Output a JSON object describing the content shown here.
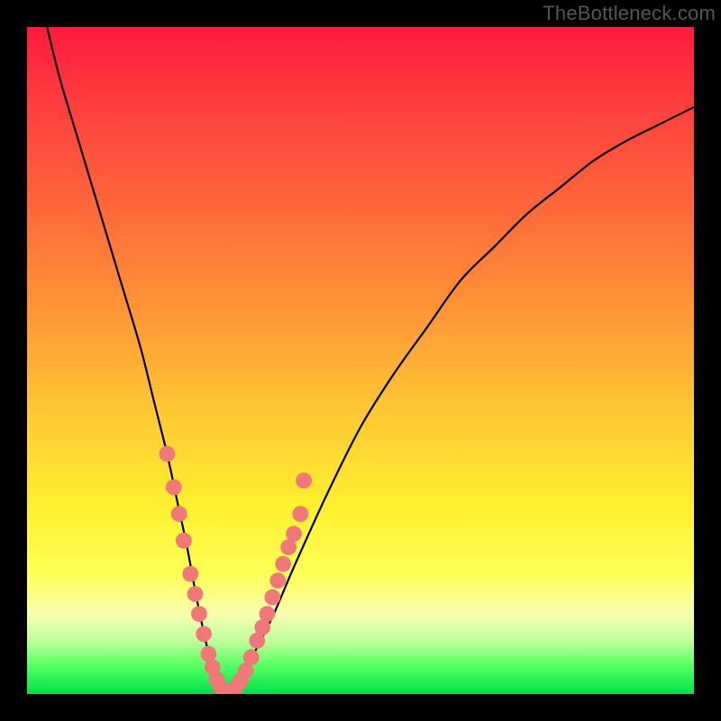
{
  "watermark": "TheBottleneck.com",
  "chart_data": {
    "type": "line",
    "title": "",
    "xlabel": "",
    "ylabel": "",
    "xlim": [
      0,
      100
    ],
    "ylim": [
      0,
      100
    ],
    "background_gradient": [
      "#ff1a3c",
      "#ff6a3a",
      "#ffc933",
      "#ffff55",
      "#00e04a"
    ],
    "series": [
      {
        "name": "bottleneck-curve",
        "color": "#000000",
        "x": [
          3,
          5,
          8,
          11,
          14,
          17,
          19,
          21,
          22.5,
          24,
          25.5,
          27,
          28,
          29,
          30,
          32,
          34,
          37,
          40,
          45,
          50,
          55,
          60,
          65,
          70,
          75,
          80,
          85,
          90,
          95,
          100
        ],
        "y": [
          100,
          92,
          82,
          72,
          62,
          52,
          44,
          36,
          29,
          22,
          14,
          7,
          3,
          0.5,
          0,
          2,
          6,
          12,
          19,
          30,
          40,
          48,
          55,
          62,
          67,
          72,
          76,
          80,
          83,
          85.5,
          88
        ]
      }
    ],
    "markers": [
      {
        "name": "highlight-dots",
        "color": "#f07878",
        "radius": 1.2,
        "points": [
          {
            "x": 21.0,
            "y": 36
          },
          {
            "x": 22.0,
            "y": 31
          },
          {
            "x": 22.8,
            "y": 27
          },
          {
            "x": 23.5,
            "y": 23
          },
          {
            "x": 24.5,
            "y": 18
          },
          {
            "x": 25.2,
            "y": 15
          },
          {
            "x": 25.8,
            "y": 12
          },
          {
            "x": 26.5,
            "y": 9
          },
          {
            "x": 27.2,
            "y": 6
          },
          {
            "x": 27.8,
            "y": 4
          },
          {
            "x": 28.4,
            "y": 2.2
          },
          {
            "x": 29.0,
            "y": 1
          },
          {
            "x": 29.5,
            "y": 0.4
          },
          {
            "x": 30.0,
            "y": 0.2
          },
          {
            "x": 30.6,
            "y": 0.3
          },
          {
            "x": 31.3,
            "y": 1
          },
          {
            "x": 32.0,
            "y": 2
          },
          {
            "x": 32.8,
            "y": 3.5
          },
          {
            "x": 33.6,
            "y": 5.5
          },
          {
            "x": 34.5,
            "y": 8
          },
          {
            "x": 35.3,
            "y": 10
          },
          {
            "x": 36.0,
            "y": 12
          },
          {
            "x": 36.8,
            "y": 14.5
          },
          {
            "x": 37.6,
            "y": 17
          },
          {
            "x": 38.4,
            "y": 19.5
          },
          {
            "x": 39.2,
            "y": 22
          },
          {
            "x": 40.0,
            "y": 24
          },
          {
            "x": 41.0,
            "y": 27
          },
          {
            "x": 41.5,
            "y": 32
          }
        ]
      }
    ]
  }
}
